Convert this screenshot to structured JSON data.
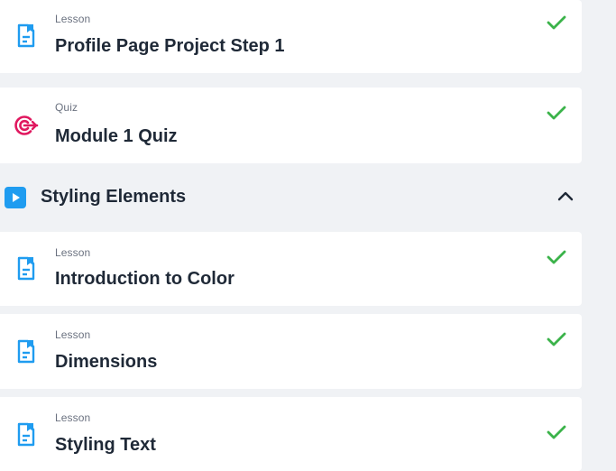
{
  "colors": {
    "accent": "#1f9cf0",
    "check": "#3bb34a",
    "quiz": "#e0185f",
    "background": "#f0f2f5"
  },
  "items": [
    {
      "kind": "Lesson",
      "title": "Profile Page Project Step 1",
      "icon": "document-icon",
      "status": "completed"
    },
    {
      "kind": "Quiz",
      "title": "Module 1 Quiz",
      "icon": "target-icon",
      "status": "completed"
    }
  ],
  "section": {
    "title": "Styling Elements",
    "icon": "play-icon",
    "expanded": true,
    "items": [
      {
        "kind": "Lesson",
        "title": "Introduction to Color",
        "icon": "document-icon",
        "status": "completed"
      },
      {
        "kind": "Lesson",
        "title": "Dimensions",
        "icon": "document-icon",
        "status": "completed"
      },
      {
        "kind": "Lesson",
        "title": "Styling Text",
        "icon": "document-icon",
        "status": "completed"
      }
    ]
  }
}
